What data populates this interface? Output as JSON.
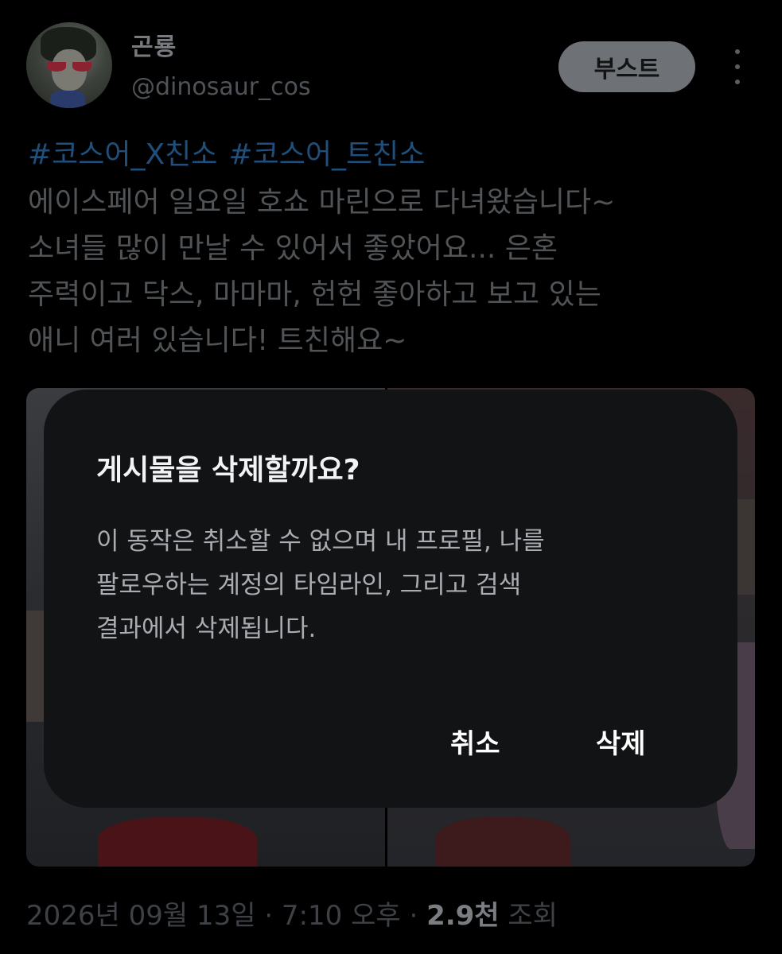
{
  "post": {
    "display_name": "곤룡",
    "handle": "@dinosaur_cos",
    "boost_label": "부스트",
    "more_icon": "more-vertical-icon",
    "hashtags": [
      "#코스어_X친소",
      "#코스어_트친소"
    ],
    "body_lines": [
      "에이스페어 일요일 호쇼 마린으로 다녀왔습니다~",
      "소녀들 많이 만날 수 있어서 좋았어요... 은혼",
      "주력이고 닥스, 마마마, 헌헌 좋아하고 보고 있는",
      "애니 여러 있습니다! 트친해요~"
    ],
    "timestamp": "2026년 09월 13일 · 7:10 오후 · ",
    "views_count": "2.9천",
    "views_label": " 조회"
  },
  "dialog": {
    "title": "게시물을 삭제할까요?",
    "message_lines": [
      "이 동작은 취소할 수 없으며 내 프로필, 나를",
      "팔로우하는 계정의 타임라인, 그리고 검색",
      "결과에서 삭제됩니다."
    ],
    "cancel_label": "취소",
    "delete_label": "삭제"
  },
  "colors": {
    "background": "#000000",
    "dialog_background": "#121315",
    "hashtag": "#1f4f7a"
  }
}
